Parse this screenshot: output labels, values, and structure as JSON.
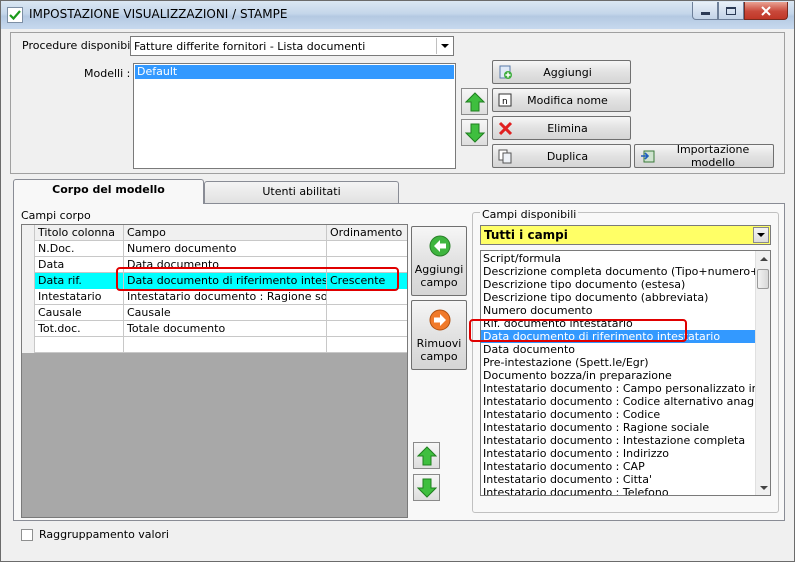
{
  "window": {
    "title": "IMPOSTAZIONE VISUALIZZAZIONI / STAMPE"
  },
  "top": {
    "procedure_label": "Procedure disponibili :",
    "procedure_value": "Fatture differite fornitori - Lista documenti",
    "modelli_label": "Modelli :",
    "modelli": [
      "Default"
    ],
    "buttons": {
      "aggiungi": "Aggiungi",
      "modifica": "Modifica nome",
      "elimina": "Elimina",
      "duplica": "Duplica",
      "importazione": "Importazione modello"
    }
  },
  "tabs": [
    {
      "label": "Corpo del modello",
      "active": true
    },
    {
      "label": "Utenti abilitati",
      "active": false
    }
  ],
  "corpo": {
    "group_label": "Campi corpo",
    "columns": [
      "Titolo colonna",
      "Campo",
      "Ordinamento"
    ],
    "rows": [
      {
        "titolo": "N.Doc.",
        "campo": "Numero documento",
        "ordinamento": ""
      },
      {
        "titolo": "Data",
        "campo": "Data documento",
        "ordinamento": ""
      },
      {
        "titolo": "Data rif.",
        "campo": "Data documento di riferimento intestatario",
        "ordinamento": "Crescente",
        "highlight": true
      },
      {
        "titolo": "Intestatario",
        "campo": "Intestatario documento : Ragione sociale",
        "ordinamento": ""
      },
      {
        "titolo": "Causale",
        "campo": "Causale",
        "ordinamento": ""
      },
      {
        "titolo": "Tot.doc.",
        "campo": "Totale documento",
        "ordinamento": ""
      },
      {
        "titolo": "",
        "campo": "",
        "ordinamento": ""
      }
    ]
  },
  "actions": {
    "aggiungi_campo": [
      "Aggiungi",
      "campo"
    ],
    "rimuovi_campo": [
      "Rimuovi",
      "campo"
    ]
  },
  "disponibili": {
    "group_label": "Campi disponibili",
    "filter_value": "Tutti i campi",
    "items": [
      "Script/formula",
      "Descrizione completa documento (Tipo+numero+data)",
      "Descrizione tipo documento (estesa)",
      "Descrizione tipo documento (abbreviata)",
      "Numero documento",
      "Rif. documento intestatario",
      "Data documento di riferimento intestatario",
      "Data documento",
      "Pre-intestazione (Spett.le/Egr)",
      "Documento bozza/in preparazione",
      "Intestatario documento : Campo personalizzato intestatario",
      "Intestatario documento : Codice alternativo anagrafica",
      "Intestatario documento : Codice",
      "Intestatario documento : Ragione sociale",
      "Intestatario documento : Intestazione completa",
      "Intestatario documento : Indirizzo",
      "Intestatario documento : CAP",
      "Intestatario documento : Citta'",
      "Intestatario documento : Telefono"
    ],
    "selected_index": 6
  },
  "footer": {
    "raggruppamento_label": "Raggruppamento valori"
  },
  "colors": {
    "selection": "#3399ff",
    "highlight_row": "#00ffff",
    "filter_bg": "#ffff66",
    "annotation": "#e00000"
  }
}
